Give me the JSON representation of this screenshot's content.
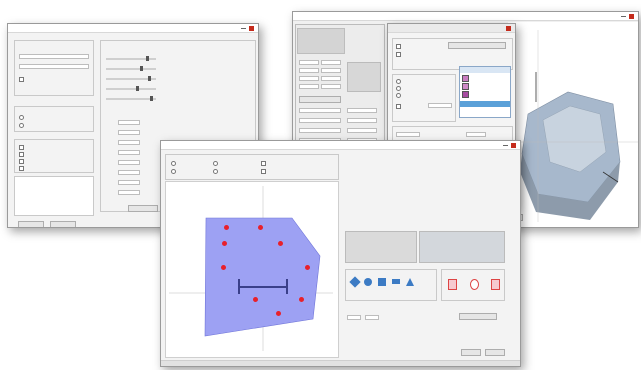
{
  "windows": {
    "left": {
      "title": "",
      "footer_label": ""
    },
    "middle": {
      "title": "",
      "ok_label": "",
      "cancel_label": ""
    },
    "right": {
      "title": ""
    }
  },
  "colors": {
    "plot_fill": "#9da1f3",
    "marker": "#e8202a",
    "shape_blue": "#3c7bc4",
    "list_highlight": "#5aa0d8",
    "terrain": "#a7b8cc",
    "red_bar": "#c31a1a"
  },
  "icons": {
    "close": "close-icon",
    "minimize": "minimize-icon",
    "maximize": "maximize-icon"
  }
}
